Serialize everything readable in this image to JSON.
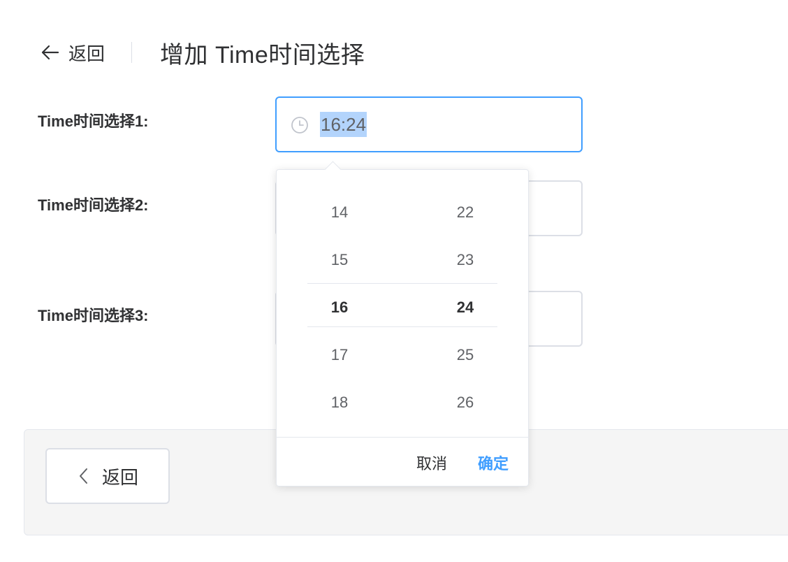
{
  "header": {
    "back_label": "返回",
    "title": "增加 Time时间选择"
  },
  "form": {
    "field1_label": "Time时间选择1:",
    "field1_value": "16:24",
    "field2_label": "Time时间选择2:",
    "field3_label": "Time时间选择3:"
  },
  "picker": {
    "hours": [
      "14",
      "15",
      "16",
      "17",
      "18"
    ],
    "minutes": [
      "22",
      "23",
      "24",
      "25",
      "26"
    ],
    "selected_hour": "16",
    "selected_minute": "24",
    "cancel_label": "取消",
    "confirm_label": "确定"
  },
  "footer": {
    "back_button_label": "返回"
  },
  "colors": {
    "accent": "#409eff",
    "selection_highlight": "#b3d4fc",
    "border": "#dcdfe6",
    "footer_bg": "#f5f5f5"
  },
  "icons": {
    "back": "arrow-left-icon",
    "clock": "clock-icon",
    "chevron": "chevron-left-icon"
  }
}
